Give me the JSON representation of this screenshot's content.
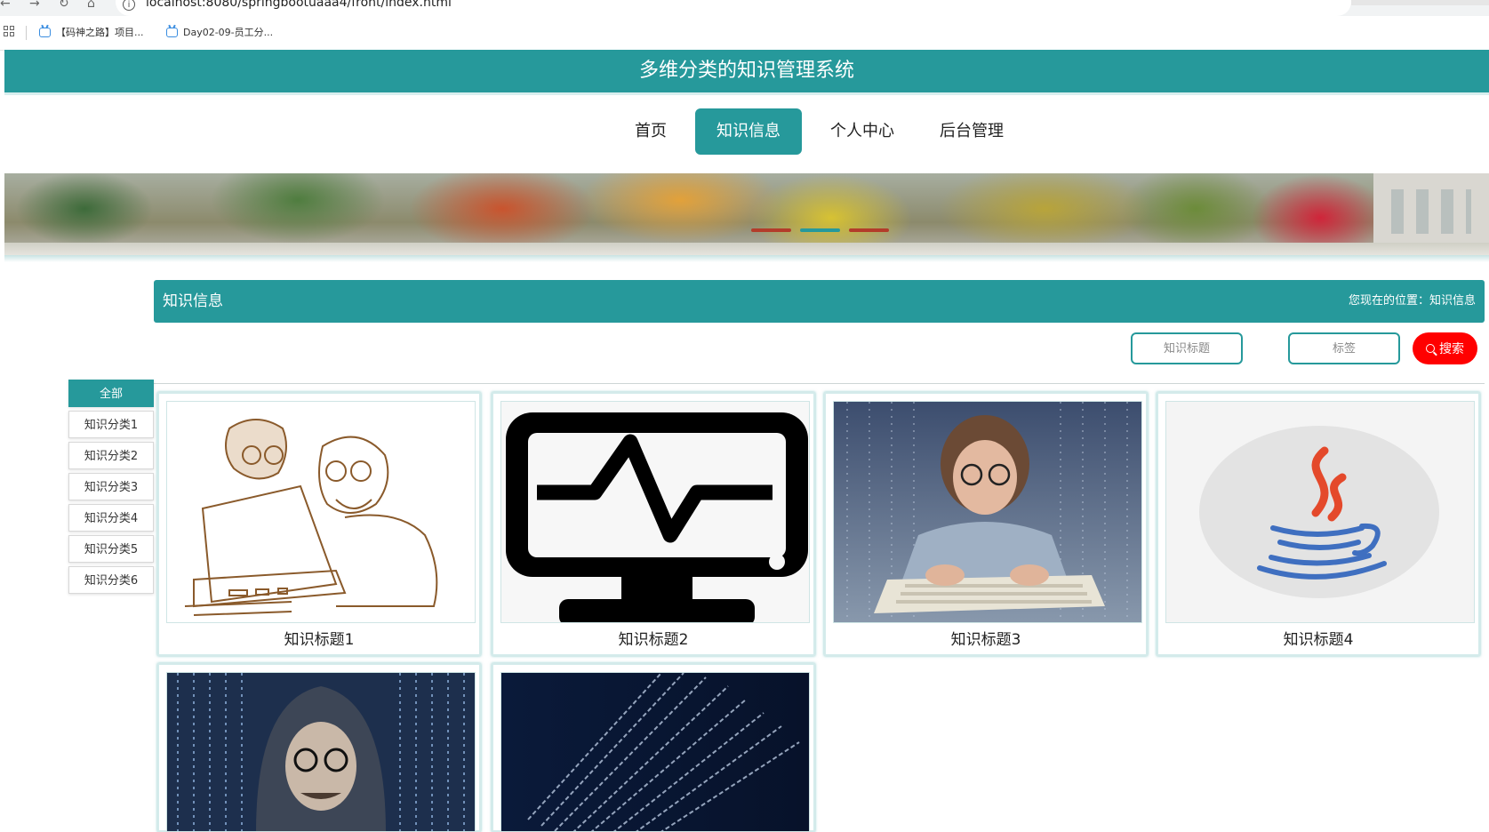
{
  "browser": {
    "url": "localhost:8080/springbootuaaa4/front/index.html",
    "bookmarks": [
      "【码神之路】项目...",
      "Day02-09-员工分..."
    ]
  },
  "site": {
    "title": "多维分类的知识管理系统",
    "nav": [
      "首页",
      "知识信息",
      "个人中心",
      "后台管理"
    ],
    "active_nav": "知识信息"
  },
  "section": {
    "title": "知识信息",
    "breadcrumb": "您现在的位置：知识信息"
  },
  "search": {
    "title_placeholder": "知识标题",
    "tag_placeholder": "标签",
    "button_label": "搜索"
  },
  "categories": [
    "全部",
    "知识分类1",
    "知识分类2",
    "知识分类3",
    "知识分类4",
    "知识分类5",
    "知识分类6"
  ],
  "cards": [
    {
      "title": "知识标题1"
    },
    {
      "title": "知识标题2"
    },
    {
      "title": "知识标题3"
    },
    {
      "title": "知识标题4"
    },
    {
      "title": ""
    },
    {
      "title": ""
    }
  ],
  "colors": {
    "primary": "#26999b",
    "search_button": "#ff0000"
  }
}
